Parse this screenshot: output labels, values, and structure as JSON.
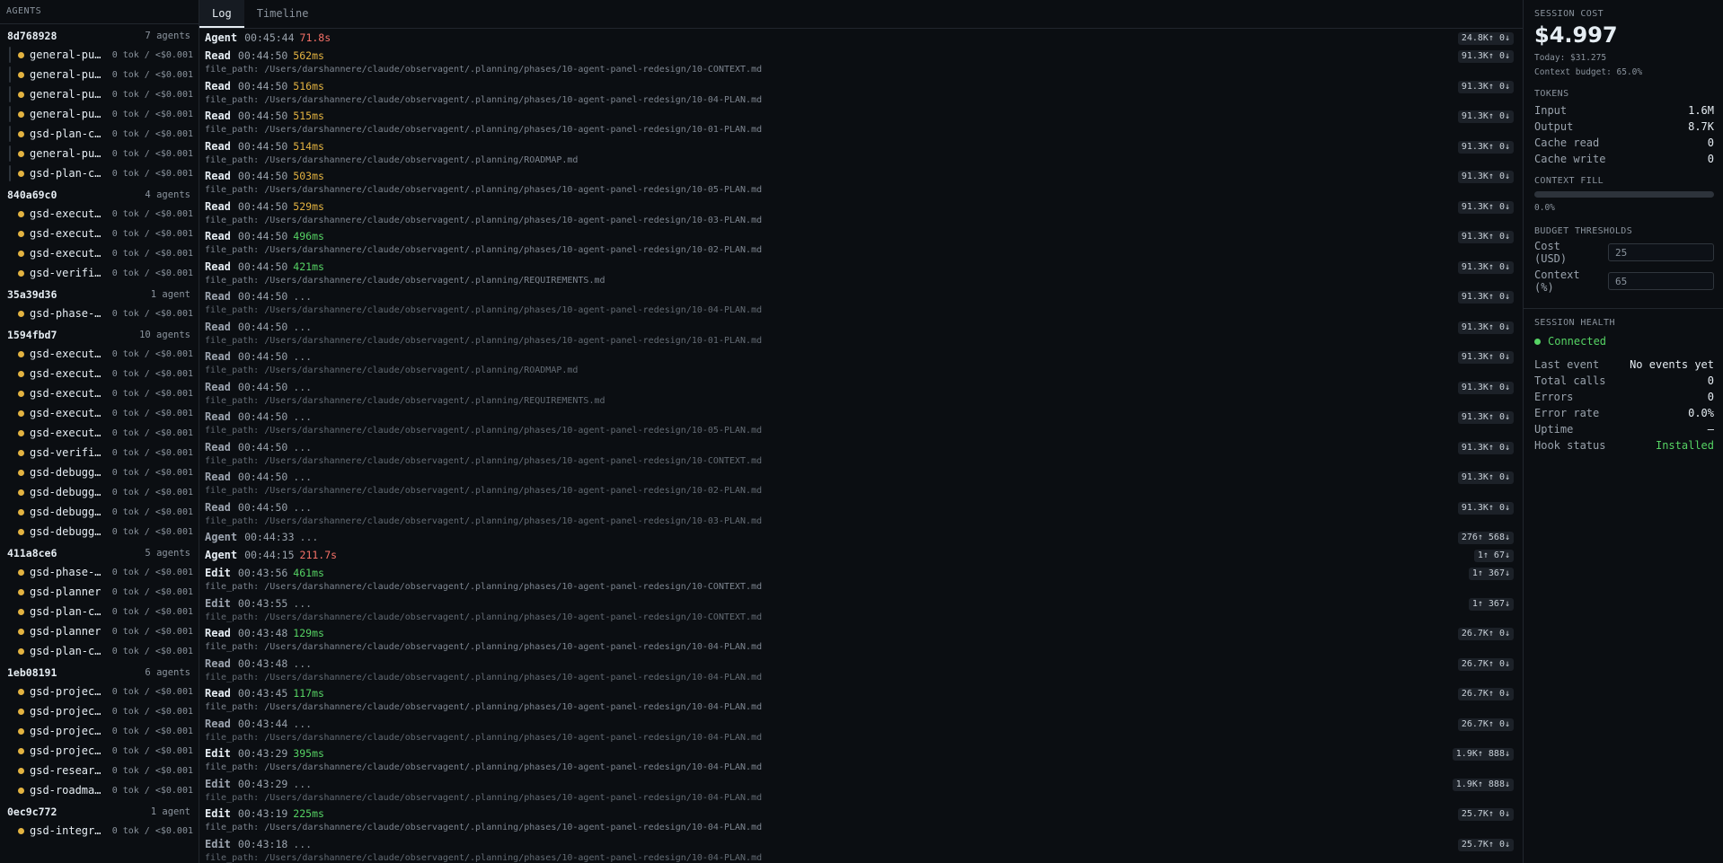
{
  "sidebar": {
    "title": "AGENTS",
    "groups": [
      {
        "id": "8d768928",
        "count": "7 agents",
        "nested": true,
        "agents": [
          {
            "name": "general-pu…",
            "stat": "0 tok / <$0.001"
          },
          {
            "name": "general-pu…",
            "stat": "0 tok / <$0.001"
          },
          {
            "name": "general-pu…",
            "stat": "0 tok / <$0.001"
          },
          {
            "name": "general-pu…",
            "stat": "0 tok / <$0.001"
          },
          {
            "name": "gsd-plan-c…",
            "stat": "0 tok / <$0.001"
          },
          {
            "name": "general-pu…",
            "stat": "0 tok / <$0.001"
          },
          {
            "name": "gsd-plan-c…",
            "stat": "0 tok / <$0.001"
          }
        ]
      },
      {
        "id": "840a69c0",
        "count": "4 agents",
        "nested": false,
        "agents": [
          {
            "name": "gsd-execut…",
            "stat": "0 tok / <$0.001"
          },
          {
            "name": "gsd-execut…",
            "stat": "0 tok / <$0.001"
          },
          {
            "name": "gsd-execut…",
            "stat": "0 tok / <$0.001"
          },
          {
            "name": "gsd-verifi…",
            "stat": "0 tok / <$0.001"
          }
        ]
      },
      {
        "id": "35a39d36",
        "count": "1 agent",
        "nested": false,
        "agents": [
          {
            "name": "gsd-phase-…",
            "stat": "0 tok / <$0.001"
          }
        ]
      },
      {
        "id": "1594fbd7",
        "count": "10 agents",
        "nested": false,
        "agents": [
          {
            "name": "gsd-execut…",
            "stat": "0 tok / <$0.001"
          },
          {
            "name": "gsd-execut…",
            "stat": "0 tok / <$0.001"
          },
          {
            "name": "gsd-execut…",
            "stat": "0 tok / <$0.001"
          },
          {
            "name": "gsd-execut…",
            "stat": "0 tok / <$0.001"
          },
          {
            "name": "gsd-execut…",
            "stat": "0 tok / <$0.001"
          },
          {
            "name": "gsd-verifi…",
            "stat": "0 tok / <$0.001"
          },
          {
            "name": "gsd-debugg…",
            "stat": "0 tok / <$0.001"
          },
          {
            "name": "gsd-debugg…",
            "stat": "0 tok / <$0.001"
          },
          {
            "name": "gsd-debugg…",
            "stat": "0 tok / <$0.001"
          },
          {
            "name": "gsd-debugg…",
            "stat": "0 tok / <$0.001"
          }
        ]
      },
      {
        "id": "411a8ce6",
        "count": "5 agents",
        "nested": false,
        "agents": [
          {
            "name": "gsd-phase-…",
            "stat": "0 tok / <$0.001"
          },
          {
            "name": "gsd-planner",
            "stat": "0 tok / <$0.001"
          },
          {
            "name": "gsd-plan-c…",
            "stat": "0 tok / <$0.001"
          },
          {
            "name": "gsd-planner",
            "stat": "0 tok / <$0.001"
          },
          {
            "name": "gsd-plan-c…",
            "stat": "0 tok / <$0.001"
          }
        ]
      },
      {
        "id": "1eb08191",
        "count": "6 agents",
        "nested": false,
        "agents": [
          {
            "name": "gsd-projec…",
            "stat": "0 tok / <$0.001"
          },
          {
            "name": "gsd-projec…",
            "stat": "0 tok / <$0.001"
          },
          {
            "name": "gsd-projec…",
            "stat": "0 tok / <$0.001"
          },
          {
            "name": "gsd-projec…",
            "stat": "0 tok / <$0.001"
          },
          {
            "name": "gsd-resear…",
            "stat": "0 tok / <$0.001"
          },
          {
            "name": "gsd-roadma…",
            "stat": "0 tok / <$0.001"
          }
        ]
      },
      {
        "id": "0ec9c772",
        "count": "1 agent",
        "nested": false,
        "agents": [
          {
            "name": "gsd-integr…",
            "stat": "0 tok / <$0.001"
          }
        ]
      }
    ]
  },
  "tabs": [
    {
      "label": "Log",
      "active": true
    },
    {
      "label": "Timeline",
      "active": false
    }
  ],
  "log": [
    {
      "tool": "Agent",
      "time": "00:45:44",
      "dur": "71.8s",
      "dur_color": "red",
      "path": "",
      "tokens": "24.8K↑ 0↓"
    },
    {
      "tool": "Read",
      "time": "00:44:50",
      "dur": "562ms",
      "dur_color": "yellow",
      "path": "file_path: /Users/darshannere/claude/observagent/.planning/phases/10-agent-panel-redesign/10-CONTEXT.md",
      "tokens": "91.3K↑ 0↓"
    },
    {
      "tool": "Read",
      "time": "00:44:50",
      "dur": "516ms",
      "dur_color": "yellow",
      "path": "file_path: /Users/darshannere/claude/observagent/.planning/phases/10-agent-panel-redesign/10-04-PLAN.md",
      "tokens": "91.3K↑ 0↓"
    },
    {
      "tool": "Read",
      "time": "00:44:50",
      "dur": "515ms",
      "dur_color": "yellow",
      "path": "file_path: /Users/darshannere/claude/observagent/.planning/phases/10-agent-panel-redesign/10-01-PLAN.md",
      "tokens": "91.3K↑ 0↓"
    },
    {
      "tool": "Read",
      "time": "00:44:50",
      "dur": "514ms",
      "dur_color": "yellow",
      "path": "file_path: /Users/darshannere/claude/observagent/.planning/ROADMAP.md",
      "tokens": "91.3K↑ 0↓"
    },
    {
      "tool": "Read",
      "time": "00:44:50",
      "dur": "503ms",
      "dur_color": "yellow",
      "path": "file_path: /Users/darshannere/claude/observagent/.planning/phases/10-agent-panel-redesign/10-05-PLAN.md",
      "tokens": "91.3K↑ 0↓"
    },
    {
      "tool": "Read",
      "time": "00:44:50",
      "dur": "529ms",
      "dur_color": "yellow",
      "path": "file_path: /Users/darshannere/claude/observagent/.planning/phases/10-agent-panel-redesign/10-03-PLAN.md",
      "tokens": "91.3K↑ 0↓"
    },
    {
      "tool": "Read",
      "time": "00:44:50",
      "dur": "496ms",
      "dur_color": "green",
      "path": "file_path: /Users/darshannere/claude/observagent/.planning/phases/10-agent-panel-redesign/10-02-PLAN.md",
      "tokens": "91.3K↑ 0↓"
    },
    {
      "tool": "Read",
      "time": "00:44:50",
      "dur": "421ms",
      "dur_color": "green",
      "path": "file_path: /Users/darshannere/claude/observagent/.planning/REQUIREMENTS.md",
      "tokens": "91.3K↑ 0↓"
    },
    {
      "tool": "Read",
      "time": "00:44:50",
      "dur": "...",
      "dur_color": "pend",
      "path": "file_path: /Users/darshannere/claude/observagent/.planning/phases/10-agent-panel-redesign/10-04-PLAN.md",
      "tokens": "91.3K↑ 0↓"
    },
    {
      "tool": "Read",
      "time": "00:44:50",
      "dur": "...",
      "dur_color": "pend",
      "path": "file_path: /Users/darshannere/claude/observagent/.planning/phases/10-agent-panel-redesign/10-01-PLAN.md",
      "tokens": "91.3K↑ 0↓"
    },
    {
      "tool": "Read",
      "time": "00:44:50",
      "dur": "...",
      "dur_color": "pend",
      "path": "file_path: /Users/darshannere/claude/observagent/.planning/ROADMAP.md",
      "tokens": "91.3K↑ 0↓"
    },
    {
      "tool": "Read",
      "time": "00:44:50",
      "dur": "...",
      "dur_color": "pend",
      "path": "file_path: /Users/darshannere/claude/observagent/.planning/REQUIREMENTS.md",
      "tokens": "91.3K↑ 0↓"
    },
    {
      "tool": "Read",
      "time": "00:44:50",
      "dur": "...",
      "dur_color": "pend",
      "path": "file_path: /Users/darshannere/claude/observagent/.planning/phases/10-agent-panel-redesign/10-05-PLAN.md",
      "tokens": "91.3K↑ 0↓"
    },
    {
      "tool": "Read",
      "time": "00:44:50",
      "dur": "...",
      "dur_color": "pend",
      "path": "file_path: /Users/darshannere/claude/observagent/.planning/phases/10-agent-panel-redesign/10-CONTEXT.md",
      "tokens": "91.3K↑ 0↓"
    },
    {
      "tool": "Read",
      "time": "00:44:50",
      "dur": "...",
      "dur_color": "pend",
      "path": "file_path: /Users/darshannere/claude/observagent/.planning/phases/10-agent-panel-redesign/10-02-PLAN.md",
      "tokens": "91.3K↑ 0↓"
    },
    {
      "tool": "Read",
      "time": "00:44:50",
      "dur": "...",
      "dur_color": "pend",
      "path": "file_path: /Users/darshannere/claude/observagent/.planning/phases/10-agent-panel-redesign/10-03-PLAN.md",
      "tokens": "91.3K↑ 0↓"
    },
    {
      "tool": "Agent",
      "time": "00:44:33",
      "dur": "...",
      "dur_color": "pend",
      "path": "",
      "tokens": "276↑ 568↓"
    },
    {
      "tool": "Agent",
      "time": "00:44:15",
      "dur": "211.7s",
      "dur_color": "red",
      "path": "",
      "tokens": "1↑ 67↓"
    },
    {
      "tool": "Edit",
      "time": "00:43:56",
      "dur": "461ms",
      "dur_color": "green",
      "path": "file_path: /Users/darshannere/claude/observagent/.planning/phases/10-agent-panel-redesign/10-CONTEXT.md",
      "tokens": "1↑ 367↓"
    },
    {
      "tool": "Edit",
      "time": "00:43:55",
      "dur": "...",
      "dur_color": "pend",
      "path": "file_path: /Users/darshannere/claude/observagent/.planning/phases/10-agent-panel-redesign/10-CONTEXT.md",
      "tokens": "1↑ 367↓"
    },
    {
      "tool": "Read",
      "time": "00:43:48",
      "dur": "129ms",
      "dur_color": "green",
      "path": "file_path: /Users/darshannere/claude/observagent/.planning/phases/10-agent-panel-redesign/10-04-PLAN.md",
      "tokens": "26.7K↑ 0↓"
    },
    {
      "tool": "Read",
      "time": "00:43:48",
      "dur": "...",
      "dur_color": "pend",
      "path": "file_path: /Users/darshannere/claude/observagent/.planning/phases/10-agent-panel-redesign/10-04-PLAN.md",
      "tokens": "26.7K↑ 0↓"
    },
    {
      "tool": "Read",
      "time": "00:43:45",
      "dur": "117ms",
      "dur_color": "green",
      "path": "file_path: /Users/darshannere/claude/observagent/.planning/phases/10-agent-panel-redesign/10-04-PLAN.md",
      "tokens": "26.7K↑ 0↓"
    },
    {
      "tool": "Read",
      "time": "00:43:44",
      "dur": "...",
      "dur_color": "pend",
      "path": "file_path: /Users/darshannere/claude/observagent/.planning/phases/10-agent-panel-redesign/10-04-PLAN.md",
      "tokens": "26.7K↑ 0↓"
    },
    {
      "tool": "Edit",
      "time": "00:43:29",
      "dur": "395ms",
      "dur_color": "green",
      "path": "file_path: /Users/darshannere/claude/observagent/.planning/phases/10-agent-panel-redesign/10-04-PLAN.md",
      "tokens": "1.9K↑ 888↓"
    },
    {
      "tool": "Edit",
      "time": "00:43:29",
      "dur": "...",
      "dur_color": "pend",
      "path": "file_path: /Users/darshannere/claude/observagent/.planning/phases/10-agent-panel-redesign/10-04-PLAN.md",
      "tokens": "1.9K↑ 888↓"
    },
    {
      "tool": "Edit",
      "time": "00:43:19",
      "dur": "225ms",
      "dur_color": "green",
      "path": "file_path: /Users/darshannere/claude/observagent/.planning/phases/10-agent-panel-redesign/10-04-PLAN.md",
      "tokens": "25.7K↑ 0↓"
    },
    {
      "tool": "Edit",
      "time": "00:43:18",
      "dur": "...",
      "dur_color": "pend",
      "path": "file_path: /Users/darshannere/claude/observagent/.planning/phases/10-agent-panel-redesign/10-04-PLAN.md",
      "tokens": "25.7K↑ 0↓"
    }
  ],
  "right": {
    "cost": {
      "title": "SESSION COST",
      "amount": "$4.997",
      "today": "Today: $31.275",
      "context_budget": "Context budget: 65.0%"
    },
    "tokens": {
      "title": "TOKENS",
      "rows": [
        {
          "k": "Input",
          "v": "1.6M"
        },
        {
          "k": "Output",
          "v": "8.7K"
        },
        {
          "k": "Cache read",
          "v": "0"
        },
        {
          "k": "Cache write",
          "v": "0"
        }
      ]
    },
    "context_fill": {
      "title": "CONTEXT FILL",
      "value": "0.0%",
      "fraction": 0.0
    },
    "thresholds": {
      "title": "BUDGET THRESHOLDS",
      "cost_label": "Cost (USD)",
      "cost_value": "25",
      "context_label": "Context (%)",
      "context_value": "65"
    },
    "health": {
      "title": "SESSION HEALTH",
      "status": "Connected",
      "rows": [
        {
          "k": "Last event",
          "v": "No events yet",
          "color": "white"
        },
        {
          "k": "Total calls",
          "v": "0",
          "color": "white"
        },
        {
          "k": "Errors",
          "v": "0",
          "color": "white"
        },
        {
          "k": "Error rate",
          "v": "0.0%",
          "color": "white"
        },
        {
          "k": "Uptime",
          "v": "—",
          "color": "white"
        },
        {
          "k": "Hook status",
          "v": "Installed",
          "color": "green"
        }
      ]
    }
  },
  "colors": {
    "accent_yellow": "#e3b341",
    "accent_green": "#56d364",
    "accent_red": "#f47067",
    "bg": "#0b0e12"
  }
}
